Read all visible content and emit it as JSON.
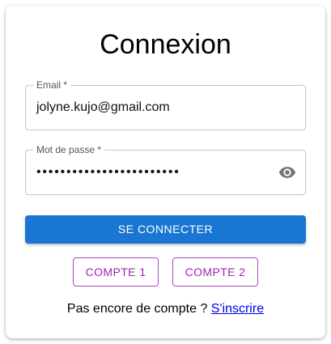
{
  "title": "Connexion",
  "email": {
    "label": "Email",
    "required_mark": "*",
    "value": "jolyne.kujo@gmail.com"
  },
  "password": {
    "label": "Mot de passe",
    "required_mark": "*",
    "masked_value": "••••••••••••••••••••••••",
    "toggle_icon": "eye-icon"
  },
  "login_button": {
    "label": "SE CONNECTER",
    "color": "#1976d2"
  },
  "account_buttons": [
    {
      "label": "COMPTE 1"
    },
    {
      "label": "COMPTE 2"
    }
  ],
  "account_button_color": "#9c27b0",
  "signup": {
    "prompt": "Pas encore de compte ?",
    "link_label": "S'inscrire"
  }
}
